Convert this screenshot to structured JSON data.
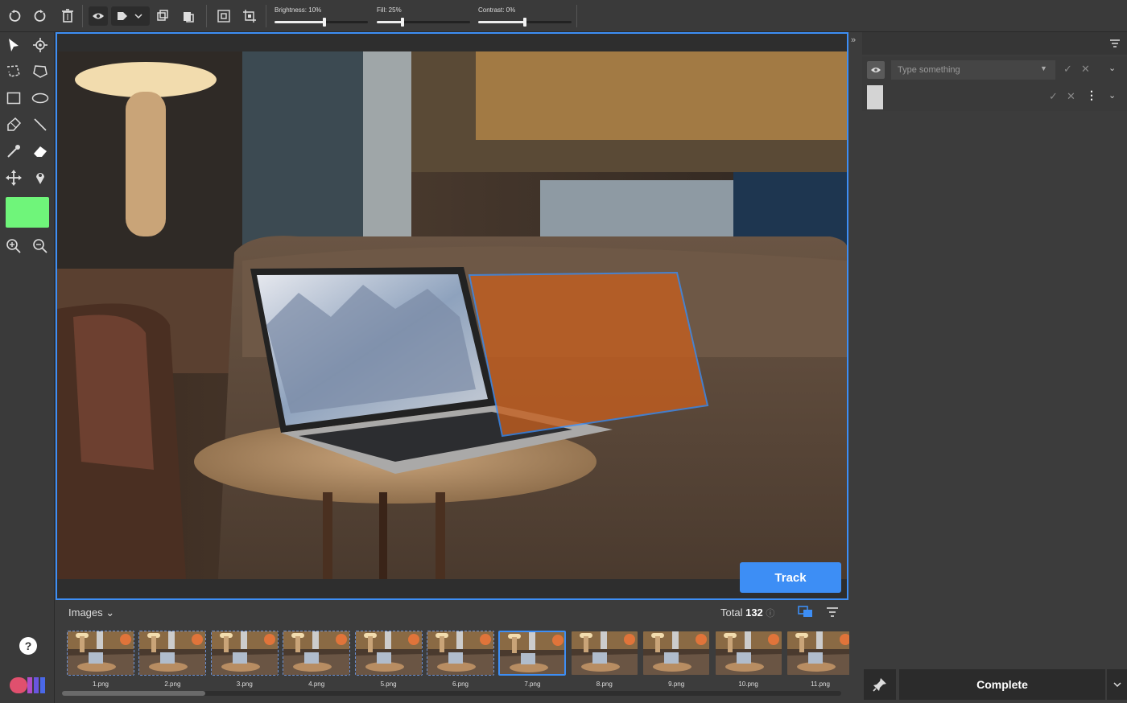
{
  "toolbar": {
    "sliders": [
      {
        "label": "Brightness: 10%",
        "value": 0.55
      },
      {
        "label": "Fill: 25%",
        "value": 0.25
      },
      {
        "label": "Contrast: 0%",
        "value": 0.5
      }
    ]
  },
  "tools": [
    "pointer",
    "crosshair",
    "lasso",
    "polygon",
    "rectangle",
    "ellipse",
    "pen",
    "line",
    "eyedropper",
    "eraser",
    "move",
    "pin",
    "zoom-in",
    "zoom-out"
  ],
  "canvas": {
    "track_label": "Track",
    "accent": "#3d8ef5",
    "annotation_color": "#c65f1f"
  },
  "strip": {
    "title": "Images",
    "total_label": "Total",
    "total_value": "132",
    "thumbnails": [
      {
        "name": "1.png"
      },
      {
        "name": "2.png"
      },
      {
        "name": "3.png"
      },
      {
        "name": "4.png"
      },
      {
        "name": "5.png"
      },
      {
        "name": "6.png"
      },
      {
        "name": "7.png"
      },
      {
        "name": "8.png"
      },
      {
        "name": "9.png"
      },
      {
        "name": "10.png"
      },
      {
        "name": "11.png"
      }
    ]
  },
  "rightpanel": {
    "label_placeholder": "Type something",
    "complete_label": "Complete"
  },
  "colors": {
    "tool_swatch": "#6ff57a"
  }
}
